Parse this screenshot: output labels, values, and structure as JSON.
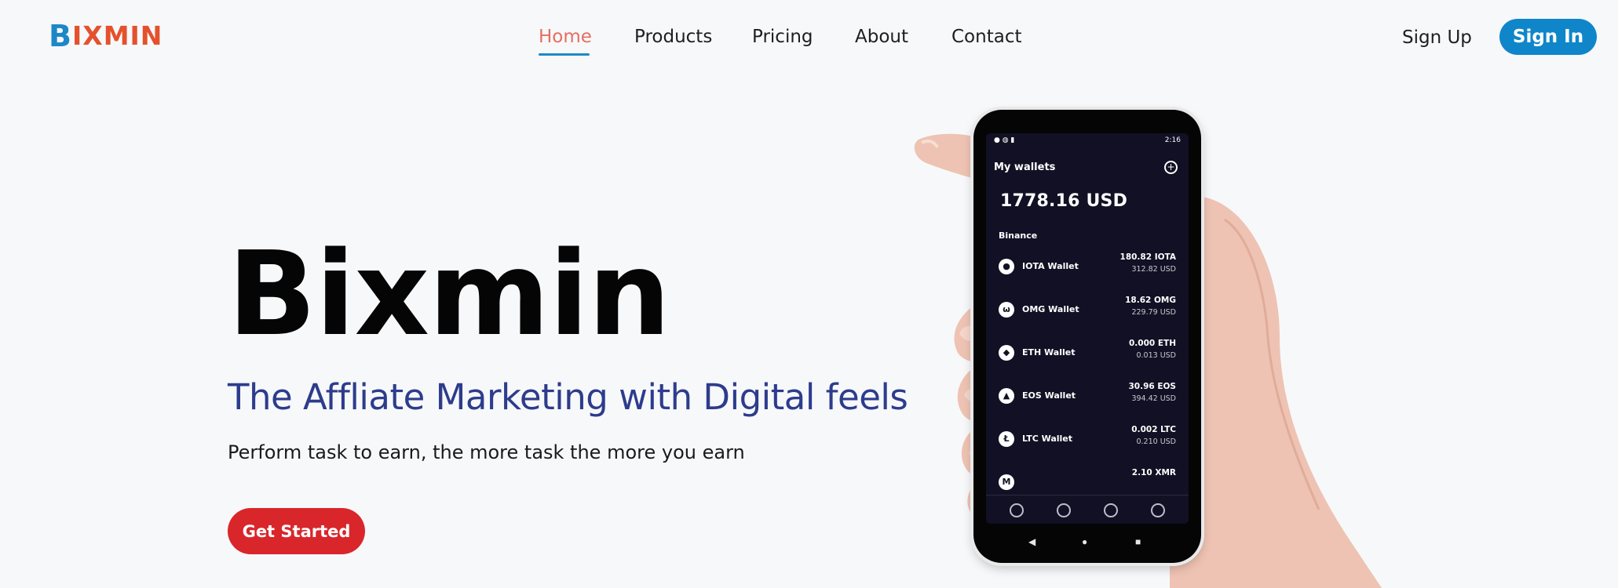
{
  "header": {
    "logo_initial": "B",
    "logo_rest": "IXMIN",
    "nav": [
      {
        "label": "Home",
        "active": true
      },
      {
        "label": "Products",
        "active": false
      },
      {
        "label": "Pricing",
        "active": false
      },
      {
        "label": "About",
        "active": false
      },
      {
        "label": "Contact",
        "active": false
      }
    ],
    "sign_up": "Sign Up",
    "sign_in": "Sign In"
  },
  "hero": {
    "title": "Bixmin",
    "subtitle": "The Affliate Marketing with Digital feels",
    "text": "Perform task to earn, the more task the more you earn",
    "cta": "Get Started"
  },
  "phone": {
    "status_time": "2:16",
    "header": "My wallets",
    "total": "1778.16 USD",
    "exchange": "Binance",
    "wallets": [
      {
        "name": "IOTA Wallet",
        "amount": "180.82 IOTA",
        "usd": "312.82 USD",
        "icon": "iota-icon"
      },
      {
        "name": "OMG Wallet",
        "amount": "18.62 OMG",
        "usd": "229.79 USD",
        "icon": "omg-icon"
      },
      {
        "name": "ETH Wallet",
        "amount": "0.000 ETH",
        "usd": "0.013 USD",
        "icon": "eth-icon"
      },
      {
        "name": "EOS Wallet",
        "amount": "30.96 EOS",
        "usd": "394.42 USD",
        "icon": "eos-icon"
      },
      {
        "name": "LTC Wallet",
        "amount": "0.002 LTC",
        "usd": "0.210 USD",
        "icon": "ltc-icon"
      },
      {
        "name": "",
        "amount": "2.10 XMR",
        "usd": "",
        "icon": "xmr-icon"
      }
    ]
  },
  "colors": {
    "brand_blue": "#1c88c7",
    "brand_orange": "#e4512d",
    "active_nav": "#e56e61",
    "subtitle": "#2d3c8c",
    "cta": "#d9262b",
    "sign_in": "#0f86c9"
  }
}
